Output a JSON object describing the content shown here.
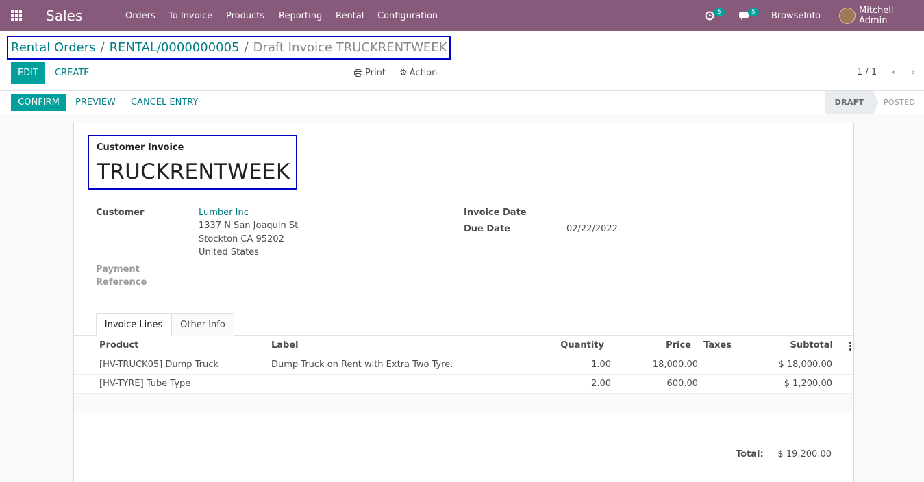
{
  "app": {
    "name": "Sales"
  },
  "menu": [
    "Orders",
    "To Invoice",
    "Products",
    "Reporting",
    "Rental",
    "Configuration"
  ],
  "systray": {
    "activity_count": "5",
    "message_count": "5",
    "company": "BrowseInfo",
    "user": "Mitchell Admin"
  },
  "breadcrumb": {
    "root": "Rental Orders",
    "sep": "/",
    "parent": "RENTAL/0000000005",
    "current": "Draft Invoice TRUCKRENTWEEK"
  },
  "toolbar": {
    "edit": "EDIT",
    "create": "CREATE",
    "print": "Print",
    "action": "Action",
    "pager": "1 / 1"
  },
  "statusbar": {
    "confirm": "CONFIRM",
    "preview": "PREVIEW",
    "cancel_entry": "CANCEL ENTRY",
    "stages": [
      "DRAFT",
      "POSTED"
    ],
    "active_stage": "DRAFT"
  },
  "invoice": {
    "type_label": "Customer Invoice",
    "name": "TRUCKRENTWEEK",
    "customer_label": "Customer",
    "customer_name": "Lumber Inc",
    "address": [
      "1337 N San Joaquin St",
      "Stockton CA 95202",
      "United States"
    ],
    "payment_ref_label": [
      "Payment",
      "Reference"
    ],
    "invoice_date_label": "Invoice Date",
    "due_date_label": "Due Date",
    "due_date": "02/22/2022"
  },
  "tabs": [
    "Invoice Lines",
    "Other Info"
  ],
  "lines": {
    "headers": {
      "product": "Product",
      "label": "Label",
      "quantity": "Quantity",
      "price": "Price",
      "taxes": "Taxes",
      "subtotal": "Subtotal"
    },
    "rows": [
      {
        "product": "[HV-TRUCK05] Dump Truck",
        "label": "Dump Truck on Rent with Extra Two Tyre.",
        "quantity": "1.00",
        "price": "18,000.00",
        "taxes": "",
        "subtotal": "$ 18,000.00"
      },
      {
        "product": "[HV-TYRE] Tube Type",
        "label": "",
        "quantity": "2.00",
        "price": "600.00",
        "taxes": "",
        "subtotal": "$ 1,200.00"
      }
    ]
  },
  "totals": {
    "label": "Total:",
    "value": "$ 19,200.00"
  },
  "colors": {
    "navbar": "#875a7b",
    "primary": "#00a09d",
    "link": "#017e84",
    "highlight_box": "#0000cc"
  },
  "icons": [
    "apps-grid-icon",
    "activity-clock-icon",
    "chat-icon",
    "print-icon",
    "gear-icon",
    "chevron-left-icon",
    "chevron-right-icon",
    "kebab-icon"
  ]
}
